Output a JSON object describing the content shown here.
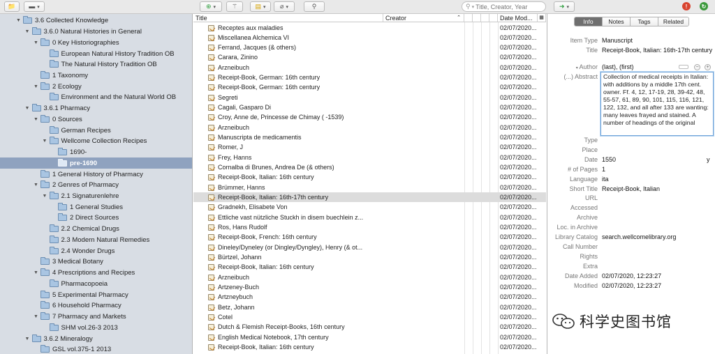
{
  "toolbar": {
    "search_placeholder": "Title, Creator, Year",
    "buttons": [
      "new-collection",
      "library-menu",
      "new-item",
      "add-by-identifier",
      "new-note",
      "attach",
      "advanced-search",
      "sync-go"
    ]
  },
  "collections": [
    {
      "label": "3.6 Collected Knowledge",
      "depth": 0,
      "expanded": true
    },
    {
      "label": "3.6.0 Natural Histories in General",
      "depth": 1,
      "expanded": true
    },
    {
      "label": "0 Key Historiographies",
      "depth": 2,
      "expanded": true
    },
    {
      "label": "European Natural History Tradition OB",
      "depth": 3,
      "expanded": null
    },
    {
      "label": "The Natural History Tradition OB",
      "depth": 3,
      "expanded": null
    },
    {
      "label": "1 Taxonomy",
      "depth": 2,
      "expanded": null
    },
    {
      "label": "2 Ecology",
      "depth": 2,
      "expanded": true
    },
    {
      "label": "Environment and the Natural World OB",
      "depth": 3,
      "expanded": null
    },
    {
      "label": "3.6.1 Pharmacy",
      "depth": 1,
      "expanded": true
    },
    {
      "label": "0 Sources",
      "depth": 2,
      "expanded": true
    },
    {
      "label": "German Recipes",
      "depth": 3,
      "expanded": null
    },
    {
      "label": "Wellcome Collection Recipes",
      "depth": 3,
      "expanded": true
    },
    {
      "label": "1690-",
      "depth": 4,
      "expanded": null
    },
    {
      "label": "pre-1690",
      "depth": 4,
      "expanded": null,
      "selected": true
    },
    {
      "label": "1 General History of Pharmacy",
      "depth": 2,
      "expanded": null
    },
    {
      "label": "2 Genres of Pharmacy",
      "depth": 2,
      "expanded": true
    },
    {
      "label": "2.1 Signaturenlehre",
      "depth": 3,
      "expanded": true
    },
    {
      "label": "1 General Studies",
      "depth": 4,
      "expanded": null
    },
    {
      "label": "2 Direct Sources",
      "depth": 4,
      "expanded": null
    },
    {
      "label": "2.2 Chemical Drugs",
      "depth": 3,
      "expanded": null
    },
    {
      "label": "2.3 Modern Natural Remedies",
      "depth": 3,
      "expanded": null
    },
    {
      "label": "2.4 Wonder Drugs",
      "depth": 3,
      "expanded": null
    },
    {
      "label": "3 Medical Botany",
      "depth": 2,
      "expanded": null
    },
    {
      "label": "4 Prescriptions and Recipes",
      "depth": 2,
      "expanded": true
    },
    {
      "label": "Pharmacopoeia",
      "depth": 3,
      "expanded": null
    },
    {
      "label": "5 Experimental Pharmacy",
      "depth": 2,
      "expanded": null
    },
    {
      "label": "6 Household Pharmacy",
      "depth": 2,
      "expanded": null
    },
    {
      "label": "7 Pharmacy and Markets",
      "depth": 2,
      "expanded": true
    },
    {
      "label": "SHM vol.26-3 2013",
      "depth": 3,
      "expanded": null
    },
    {
      "label": "3.6.2 Mineralogy",
      "depth": 1,
      "expanded": true
    },
    {
      "label": "GSL vol.375-1 2013",
      "depth": 2,
      "expanded": null
    }
  ],
  "items_header": {
    "title": "Title",
    "creator": "Creator",
    "date_modified": "Date Mod..."
  },
  "items": [
    {
      "title": "Receptes aux maladies",
      "date": "02/07/2020..."
    },
    {
      "title": "Miscellanea Alchemica VI",
      "date": "02/07/2020..."
    },
    {
      "title": "Ferrand, Jacques (& others)",
      "date": "02/07/2020..."
    },
    {
      "title": "Carara, Zinino",
      "date": "02/07/2020..."
    },
    {
      "title": "Arzneibuch",
      "date": "02/07/2020..."
    },
    {
      "title": "Receipt-Book, German: 16th century",
      "date": "02/07/2020..."
    },
    {
      "title": "Receipt-Book, German: 16th century",
      "date": "02/07/2020..."
    },
    {
      "title": "Segreti",
      "date": "02/07/2020..."
    },
    {
      "title": "Cagali, Gasparo Di",
      "date": "02/07/2020..."
    },
    {
      "title": "Croy, Anne de, Princesse de Chimay ( -1539)",
      "date": "02/07/2020..."
    },
    {
      "title": "Arzneibuch",
      "date": "02/07/2020..."
    },
    {
      "title": "Manuscripta de medicamentis",
      "date": "02/07/2020..."
    },
    {
      "title": "Romer, J",
      "date": "02/07/2020..."
    },
    {
      "title": "Frey, Hanns",
      "date": "02/07/2020..."
    },
    {
      "title": "Cornalba di Brunes, Andrea De (& others)",
      "date": "02/07/2020..."
    },
    {
      "title": "Receipt-Book, Italian: 16th century",
      "date": "02/07/2020..."
    },
    {
      "title": "Brümmer, Hanns",
      "date": "02/07/2020..."
    },
    {
      "title": "Receipt-Book, Italian: 16th-17th century",
      "date": "02/07/2020...",
      "selected": true
    },
    {
      "title": "Gradnekh, Elisabete Von",
      "date": "02/07/2020..."
    },
    {
      "title": "Ettliche vast nützliche Stuckh in disem buechlein z...",
      "date": "02/07/2020..."
    },
    {
      "title": "Ros, Hans Rudolf",
      "date": "02/07/2020..."
    },
    {
      "title": "Receipt-Book, French: 16th century",
      "date": "02/07/2020..."
    },
    {
      "title": "Dineley/Dyneley (or Dingley/Dyngley), Henry (& ot...",
      "date": "02/07/2020..."
    },
    {
      "title": "Bürtzel, Johann",
      "date": "02/07/2020..."
    },
    {
      "title": "Receipt-Book, Italian: 16th century",
      "date": "02/07/2020..."
    },
    {
      "title": "Arzneibuch",
      "date": "02/07/2020..."
    },
    {
      "title": "Artzeney-Buch",
      "date": "02/07/2020..."
    },
    {
      "title": "Artzneybuch",
      "date": "02/07/2020..."
    },
    {
      "title": "Betz, Johann",
      "date": "02/07/2020..."
    },
    {
      "title": "Cotel",
      "date": "02/07/2020..."
    },
    {
      "title": "Dutch & Flemish Receipt-Books, 16th century",
      "date": "02/07/2020..."
    },
    {
      "title": "English Medical Notebook, 17th century",
      "date": "02/07/2020..."
    },
    {
      "title": "Receipt-Book, Italian: 16th century",
      "date": "02/07/2020..."
    }
  ],
  "info": {
    "tabs": [
      "Info",
      "Notes",
      "Tags",
      "Related"
    ],
    "active_tab": "Info",
    "item_type_label": "Item Type",
    "item_type": "Manuscript",
    "title_label": "Title",
    "title": "Receipt-Book, Italian: 16th-17th century",
    "author_label": "Author",
    "author": "(last), (first)",
    "abstract_label": "(...) Abstract",
    "abstract": "Collection of medical receipts in Italian: with additions by a middle 17th cent. owner. Ff. 4, 12, 17-19, 28, 39-42, 48, 55-57, 61, 89, 90, 101, 115, 116, 121, 122, 132, and all after 133 are wanting: many leaves frayed and stained. A number of headings of the original",
    "fields": [
      {
        "label": "Type",
        "value": ""
      },
      {
        "label": "Place",
        "value": ""
      },
      {
        "label": "Date",
        "value": "1550",
        "suffix": "y"
      },
      {
        "label": "# of Pages",
        "value": "1"
      },
      {
        "label": "Language",
        "value": "ita"
      },
      {
        "label": "Short Title",
        "value": "Receipt-Book, Italian"
      },
      {
        "label": "URL",
        "value": ""
      },
      {
        "label": "Accessed",
        "value": ""
      },
      {
        "label": "Archive",
        "value": ""
      },
      {
        "label": "Loc. in Archive",
        "value": ""
      },
      {
        "label": "Library Catalog",
        "value": "search.wellcomelibrary.org"
      },
      {
        "label": "Call Number",
        "value": ""
      },
      {
        "label": "Rights",
        "value": ""
      },
      {
        "label": "Extra",
        "value": ""
      },
      {
        "label": "Date Added",
        "value": "02/07/2020, 12:23:27"
      },
      {
        "label": "Modified",
        "value": "02/07/2020, 12:23:27"
      }
    ]
  },
  "watermark": {
    "text": "科学史图书馆"
  },
  "colors": {
    "selected_collection": "#8fa2bf",
    "pane_bg": "#d8dde4",
    "accent_blue": "#6fa3d8"
  }
}
